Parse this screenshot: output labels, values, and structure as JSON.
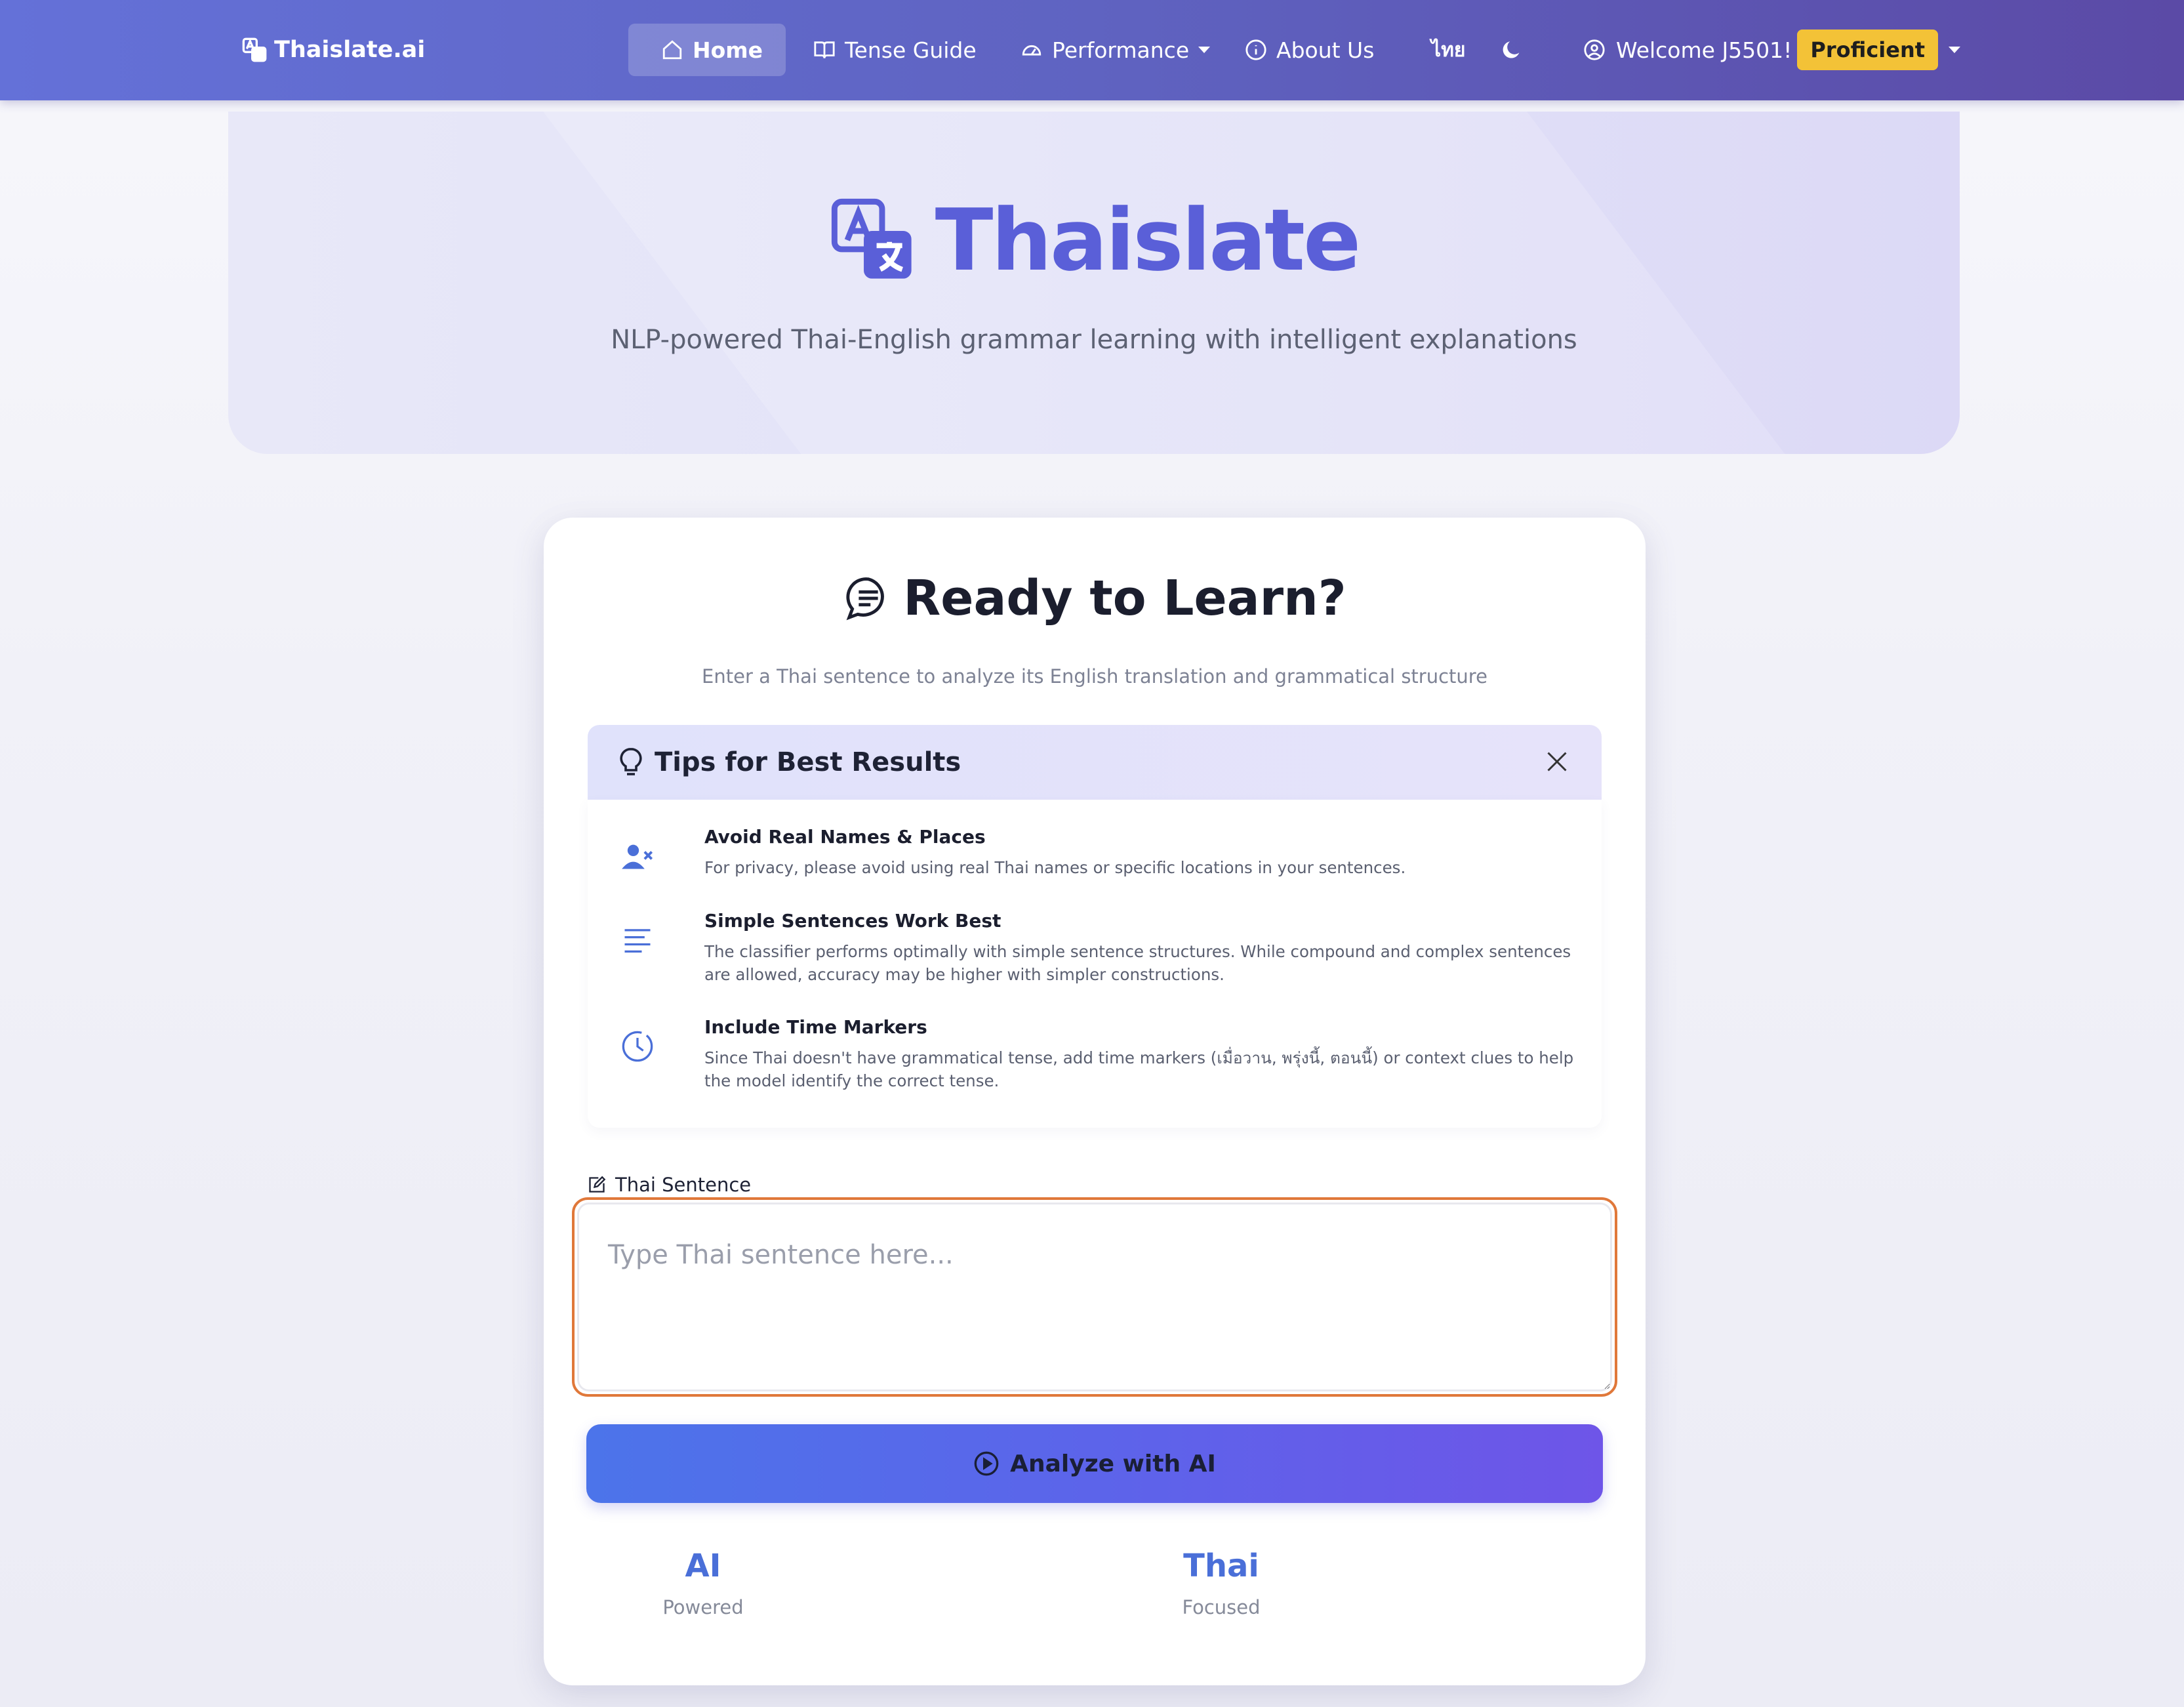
{
  "nav": {
    "brand": "Thaislate.ai",
    "home": "Home",
    "tense_guide": "Tense Guide",
    "performance": "Performance",
    "about": "About Us",
    "language": "ไทย",
    "welcome": "Welcome J5501!",
    "level": "Proficient",
    "theme_icon": "moon-icon"
  },
  "hero": {
    "title": "Thaislate",
    "subtitle": "NLP-powered Thai-English grammar learning with intelligent explanations"
  },
  "card": {
    "title": "Ready to Learn?",
    "subtitle": "Enter a Thai sentence to analyze its English translation and grammatical structure",
    "tips": {
      "heading": "Tips for Best Results",
      "items": [
        {
          "icon": "user-x-icon",
          "title": "Avoid Real Names & Places",
          "text": "For privacy, please avoid using real Thai names or specific locations in your sentences."
        },
        {
          "icon": "text-lines-icon",
          "title": "Simple Sentences Work Best",
          "text": "The classifier performs optimally with simple sentence structures. While compound and complex sentences are allowed, accuracy may be higher with simpler constructions."
        },
        {
          "icon": "clock-icon",
          "title": "Include Time Markers",
          "text": "Since Thai doesn't have grammatical tense, add time markers (เมื่อวาน, พรุ่งนี้, ตอนนี้) or context clues to help the model identify the correct tense."
        }
      ]
    },
    "input": {
      "label": "Thai Sentence",
      "placeholder": "Type Thai sentence here...",
      "value": ""
    },
    "analyze_button": "Analyze with AI",
    "stats": [
      {
        "big": "AI",
        "small": "Powered"
      },
      {
        "big": "Thai",
        "small": "Focused"
      }
    ]
  },
  "colors": {
    "accent": "#5a5fd8",
    "badge": "#f3c237",
    "focus_ring": "#e0783a"
  }
}
